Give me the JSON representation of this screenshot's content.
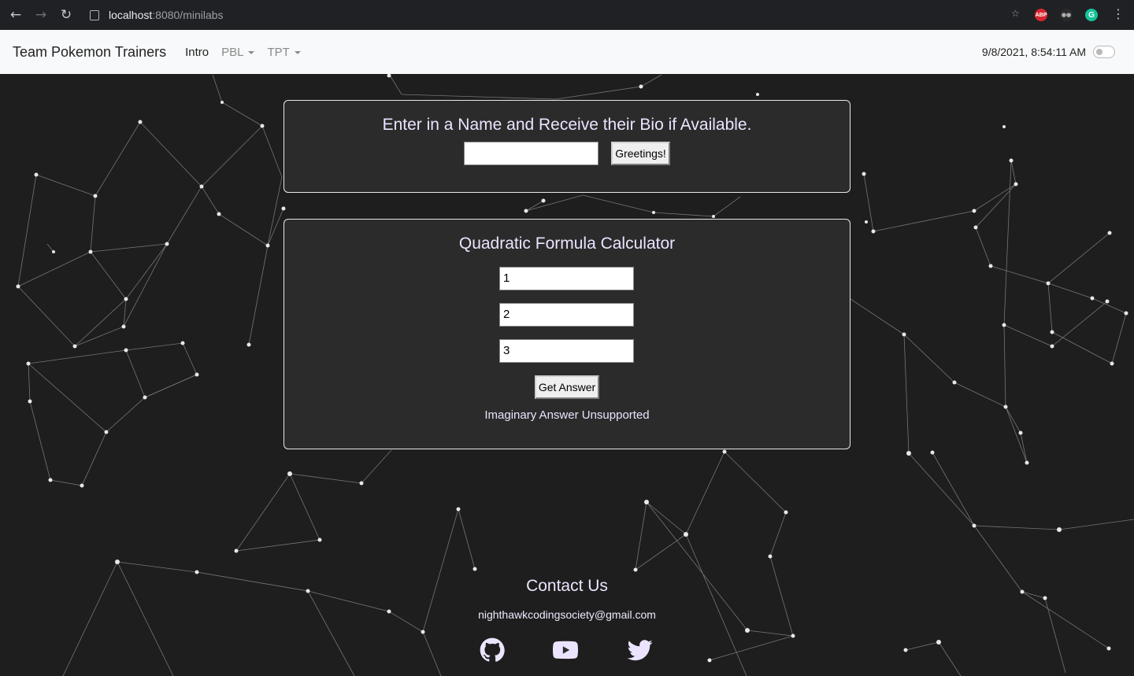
{
  "browser": {
    "url_host": "localhost",
    "url_path": ":8080/minilabs",
    "extensions": [
      "star-icon",
      "adblock-plus-icon",
      "owl-icon",
      "grammarly-icon"
    ],
    "abp_label": "ABP",
    "grammarly_label": "G"
  },
  "navbar": {
    "brand": "Team Pokemon Trainers",
    "items": [
      {
        "label": "Intro"
      },
      {
        "label": "PBL"
      },
      {
        "label": "TPT"
      }
    ],
    "clock": "9/8/2021, 8:54:11 AM",
    "dark_mode_toggle": false
  },
  "bio_card": {
    "title": "Enter in a Name and Receive their Bio if Available.",
    "name_value": "",
    "button": "Greetings!"
  },
  "quadratic_card": {
    "title": "Quadratic Formula Calculator",
    "a": "1",
    "b": "2",
    "c": "3",
    "button": "Get Answer",
    "result": "Imaginary Answer Unsupported"
  },
  "footer": {
    "title": "Contact Us",
    "email": "nighthawkcodingsociety@gmail.com",
    "socials": [
      "github-icon",
      "youtube-icon",
      "twitter-icon"
    ]
  },
  "colors": {
    "background": "#1e1e1e",
    "card": "#2b2b2b",
    "text": "#ece4ff",
    "navbar": "#f8f9fa"
  }
}
